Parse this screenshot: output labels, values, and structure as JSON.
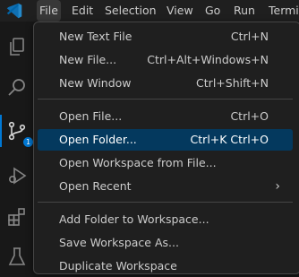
{
  "menubar": {
    "items": [
      "File",
      "Edit",
      "Selection",
      "View",
      "Go",
      "Run",
      "Termi"
    ]
  },
  "activitybar": {
    "badge": "1"
  },
  "file_menu": {
    "items": [
      {
        "label": "New Text File",
        "shortcut": "Ctrl+N"
      },
      {
        "label": "New File...",
        "shortcut": "Ctrl+Alt+Windows+N"
      },
      {
        "label": "New Window",
        "shortcut": "Ctrl+Shift+N"
      },
      {
        "label": "Open File...",
        "shortcut": "Ctrl+O"
      },
      {
        "label": "Open Folder...",
        "shortcut": "Ctrl+K Ctrl+O"
      },
      {
        "label": "Open Workspace from File...",
        "shortcut": ""
      },
      {
        "label": "Open Recent",
        "shortcut": ""
      },
      {
        "label": "Add Folder to Workspace...",
        "shortcut": ""
      },
      {
        "label": "Save Workspace As...",
        "shortcut": ""
      },
      {
        "label": "Duplicate Workspace",
        "shortcut": ""
      }
    ],
    "submenu_indicator": "›"
  },
  "colors": {
    "accent": "#0078d4",
    "selected_bg": "#04395e",
    "menu_bg": "#1f1f1f"
  }
}
